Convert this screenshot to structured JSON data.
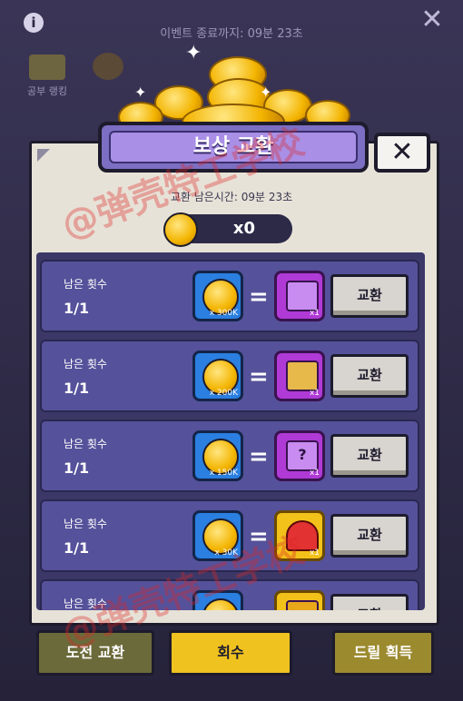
{
  "top": {
    "info_icon": "i",
    "close_icon": "✕",
    "event_timer": "이벤트 종료까지: 09분 23초",
    "rank_tab": "공부 랭킹"
  },
  "panel": {
    "title": "보상 교환",
    "close_icon": "✕",
    "exchange_timer": "교환 남은시간: 09분 23초",
    "balance": "x0"
  },
  "rows": [
    {
      "label": "남은 횟수",
      "count": "1/1",
      "cost": "x 300K",
      "reward_qty": "x1",
      "reward": "pink-chest-s",
      "button": "교환"
    },
    {
      "label": "남은 횟수",
      "count": "1/1",
      "cost": "x 200K",
      "reward_qty": "x1",
      "reward": "gold-chest-s",
      "button": "교환"
    },
    {
      "label": "남은 횟수",
      "count": "1/1",
      "cost": "x 150K",
      "reward_qty": "x1",
      "reward": "mystery-chest-s",
      "button": "교환"
    },
    {
      "label": "남은 횟수",
      "count": "1/1",
      "cost": "x 30K",
      "reward_qty": "x1",
      "reward": "jester-hat",
      "button": "교환"
    },
    {
      "label": "남은 횟수",
      "count": "",
      "cost": "",
      "reward_qty": "",
      "reward": "gold-item",
      "button": "교환"
    }
  ],
  "bottom": {
    "left_label": "도전 교환",
    "mid_label": "회수",
    "right_label": "드릴 획득"
  },
  "watermark": "@弹壳特工学校",
  "colors": {
    "panel": "#e7e2d7",
    "row": "#55519a",
    "cost_bg": "#2a7fe0",
    "reward_bg": "#b03ad6",
    "title": "#a98fe6"
  }
}
